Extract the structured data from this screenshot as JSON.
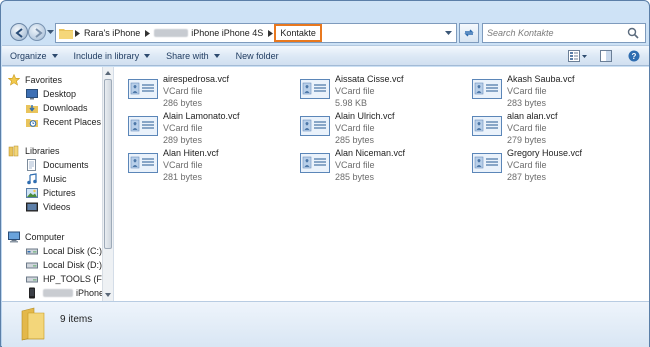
{
  "address_bar": {
    "crumbs": [
      "Rara's iPhone",
      "iPhone iPhone 4S",
      "Kontakte"
    ],
    "active_crumb": "Kontakte"
  },
  "search": {
    "placeholder": "Search Kontakte"
  },
  "toolbar": {
    "organize": "Organize",
    "include_in_library": "Include in library",
    "share_with": "Share with",
    "new_folder": "New folder"
  },
  "nav": {
    "favorites": {
      "label": "Favorites",
      "items": [
        "Desktop",
        "Downloads",
        "Recent Places"
      ]
    },
    "libraries": {
      "label": "Libraries",
      "items": [
        "Documents",
        "Music",
        "Pictures",
        "Videos"
      ]
    },
    "computer": {
      "label": "Computer",
      "items": [
        "Local Disk (C:)",
        "Local Disk (D:)",
        "HP_TOOLS (F:)",
        "iPhone"
      ]
    }
  },
  "files": [
    {
      "name": "airespedrosa.vcf",
      "type": "VCard file",
      "size": "286 bytes"
    },
    {
      "name": "Aissata Cisse.vcf",
      "type": "VCard file",
      "size": "5.98 KB"
    },
    {
      "name": "Akash Sauba.vcf",
      "type": "VCard file",
      "size": "283 bytes"
    },
    {
      "name": "Alain Lamonato.vcf",
      "type": "VCard file",
      "size": "289 bytes"
    },
    {
      "name": "Alain Ulrich.vcf",
      "type": "VCard file",
      "size": "285 bytes"
    },
    {
      "name": "alan alan.vcf",
      "type": "VCard file",
      "size": "279 bytes"
    },
    {
      "name": "Alan Hiten.vcf",
      "type": "VCard file",
      "size": "281 bytes"
    },
    {
      "name": "Alan Niceman.vcf",
      "type": "VCard file",
      "size": "285 bytes"
    },
    {
      "name": "Gregory House.vcf",
      "type": "VCard file",
      "size": "287 bytes"
    }
  ],
  "details": {
    "item_count": "9 items"
  },
  "colors": {
    "accent_highlight": "#e8781f",
    "window_frame": "#b9d3ee"
  }
}
